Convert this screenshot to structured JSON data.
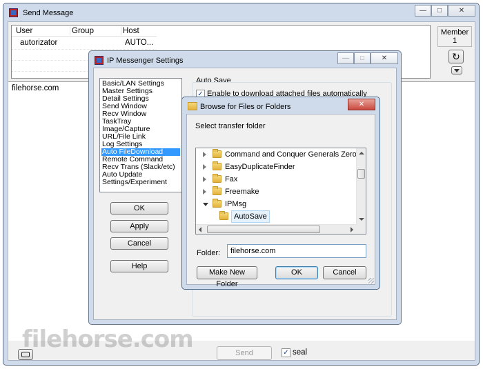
{
  "main_window": {
    "title": "Send Message",
    "columns": [
      "User",
      "Group",
      "Host"
    ],
    "row": {
      "user": "autorizator",
      "group": "",
      "host": "AUTO..."
    },
    "member_label": "Member",
    "member_count": "1",
    "message_text": "filehorse.com",
    "send_label": "Send",
    "seal_label": "seal",
    "seal_checked": true,
    "watermark": "filehorse.com"
  },
  "settings": {
    "title": "IP Messenger Settings",
    "categories": [
      "Basic/LAN Settings",
      "Master Settings",
      "Detail Settings",
      "Send Window",
      "Recv Window",
      "TaskTray",
      "Image/Capture",
      "URL/File Link",
      "Log Settings",
      "Auto FileDownload",
      "Remote Command",
      "Recv Trans (Slack/etc)",
      "Auto Update",
      "Settings/Experiment"
    ],
    "selected_index": 9,
    "ok_label": "OK",
    "apply_label": "Apply",
    "cancel_label": "Cancel",
    "help_label": "Help",
    "section_title": "Auto Save",
    "enable_label": "Enable to download attached files automatically",
    "enable_checked": true
  },
  "browse": {
    "title": "Browse for Files or Folders",
    "prompt": "Select transfer folder",
    "tree": [
      {
        "label": "Command and Conquer Generals Zero H",
        "expanded": false,
        "level": 0,
        "selected": false
      },
      {
        "label": "EasyDuplicateFinder",
        "expanded": false,
        "level": 0,
        "selected": false
      },
      {
        "label": "Fax",
        "expanded": false,
        "level": 0,
        "selected": false
      },
      {
        "label": "Freemake",
        "expanded": false,
        "level": 0,
        "selected": false
      },
      {
        "label": "IPMsg",
        "expanded": true,
        "level": 0,
        "selected": false
      },
      {
        "label": "AutoSave",
        "expanded": null,
        "level": 1,
        "selected": true
      }
    ],
    "folder_label": "Folder:",
    "folder_value": "filehorse.com",
    "make_folder_label": "Make New Folder",
    "ok_label": "OK",
    "cancel_label": "Cancel"
  },
  "colors": {
    "selection": "#3399ff",
    "close_red": "#c94a3f",
    "panel_bg": "#f0f0f0"
  }
}
